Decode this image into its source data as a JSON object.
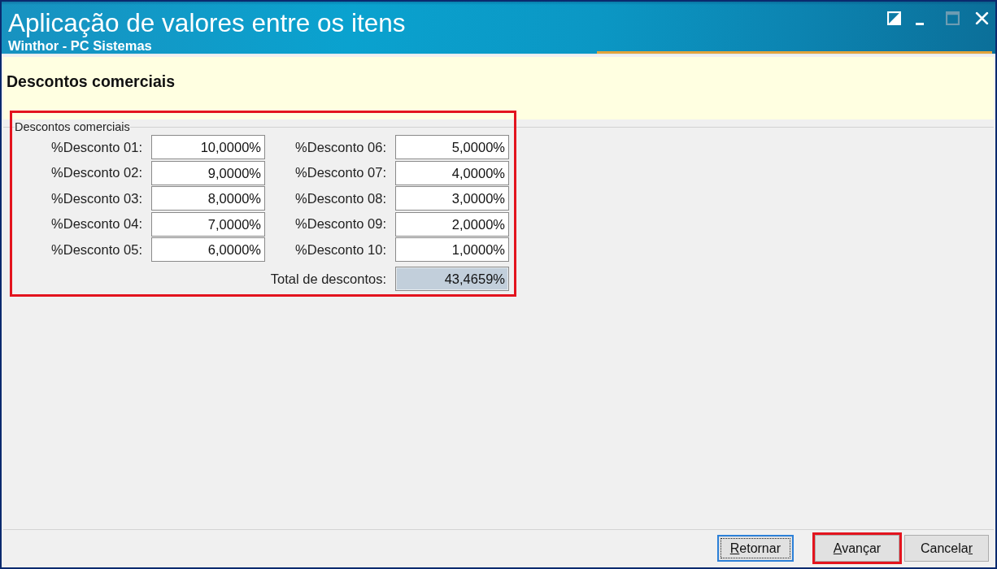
{
  "window": {
    "title": "Aplicação de valores entre os itens",
    "subtitle": "Winthor - PC Sistemas",
    "controls": [
      {
        "kind": "contrast",
        "disabled": false
      },
      {
        "kind": "minimize",
        "disabled": false
      },
      {
        "kind": "maximize",
        "disabled": true
      },
      {
        "kind": "close",
        "disabled": false
      }
    ]
  },
  "header": {
    "title": "Descontos comerciais"
  },
  "group": {
    "legend": "Descontos comerciais",
    "highlighted": true,
    "fields": [
      {
        "label": "%Desconto 01:",
        "value": "10,0000%"
      },
      {
        "label": "%Desconto 02:",
        "value": "9,0000%"
      },
      {
        "label": "%Desconto 03:",
        "value": "8,0000%"
      },
      {
        "label": "%Desconto 04:",
        "value": "7,0000%"
      },
      {
        "label": "%Desconto 05:",
        "value": "6,0000%"
      },
      {
        "label": "%Desconto 06:",
        "value": "5,0000%"
      },
      {
        "label": "%Desconto 07:",
        "value": "4,0000%"
      },
      {
        "label": "%Desconto 08:",
        "value": "3,0000%"
      },
      {
        "label": "%Desconto 09:",
        "value": "2,0000%"
      },
      {
        "label": "%Desconto 10:",
        "value": "1,0000%"
      }
    ],
    "total": {
      "label": "Total de descontos:",
      "value": "43,4659%",
      "readonly": true
    }
  },
  "buttons": [
    {
      "access_key": "R",
      "label_end": "etornar",
      "focused": true,
      "highlighted": false
    },
    {
      "access_key": "A",
      "label_end": "vançar",
      "focused": false,
      "highlighted": true
    },
    {
      "label_start": "Cancela",
      "access_key": "r",
      "focused": false,
      "highlighted": false
    }
  ]
}
